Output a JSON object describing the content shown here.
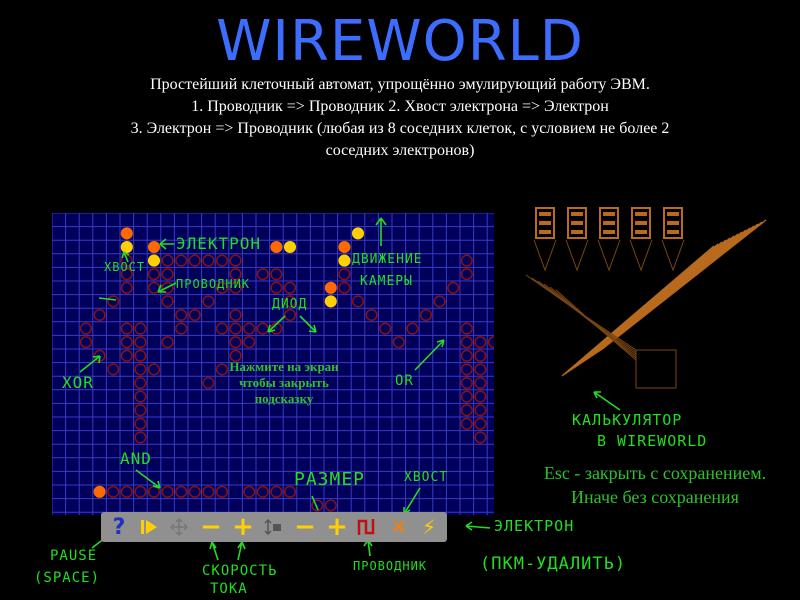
{
  "title": "WIREWORLD",
  "description": {
    "line1": "Простейший клеточный автомат, упрощённо эмулирующий работу ЭВМ.",
    "line2": "1. Проводник => Проводник 2. Хвост электрона => Электрон",
    "line3": "3. Электрон => Проводник (любая из 8 соседних клеток, с условием не более 2",
    "line4": "соседних электронов)"
  },
  "hint_text": "Нажмите на экран чтобы закрыть подсказку",
  "escape_text": {
    "line1": "Esc - закрыть с сохранением.",
    "line2": "Иначе без сохранения"
  },
  "annotations": {
    "electron": "ЭЛЕКТРОН",
    "tail": "ХВОСТ",
    "conductor": "ПРОВОДНИК",
    "diode": "ДИОД",
    "camera_move_1": "ДВИЖЕНИЕ",
    "camera_move_2": "КАМЕРЫ",
    "xor": "XOR",
    "or": "OR",
    "and": "AND",
    "calculator_1": "КАЛЬКУЛЯТОР",
    "calculator_2": "В WIREWORLD",
    "size": "РАЗМЕР",
    "tb_tail": "ХВОСТ",
    "tb_electron": "ЭЛЕКТРОН",
    "pause_1": "PAUSE",
    "pause_2": "(SPACE)",
    "speed_1": "СКОРОСТЬ",
    "speed_2": "ТОКА",
    "tb_conductor": "ПРОВОДНИК",
    "rmb_delete": "(ПКМ-УДАЛИТЬ)"
  },
  "toolbar": {
    "help_icon": "?",
    "speed_minus": "−",
    "speed_plus": "+",
    "size_minus": "−",
    "size_plus": "+",
    "close_icon": "✕",
    "electron_icon": "⚡"
  },
  "colors": {
    "background": "#000000",
    "grid_background": "#00005a",
    "grid_lines": "#3a3ac8",
    "conductor": "#8a1010",
    "electron": "#ffd000",
    "tail": "#ff6a00",
    "title": "#3d6dff",
    "annotation": "#22dd22",
    "toolbar": "#909090"
  }
}
